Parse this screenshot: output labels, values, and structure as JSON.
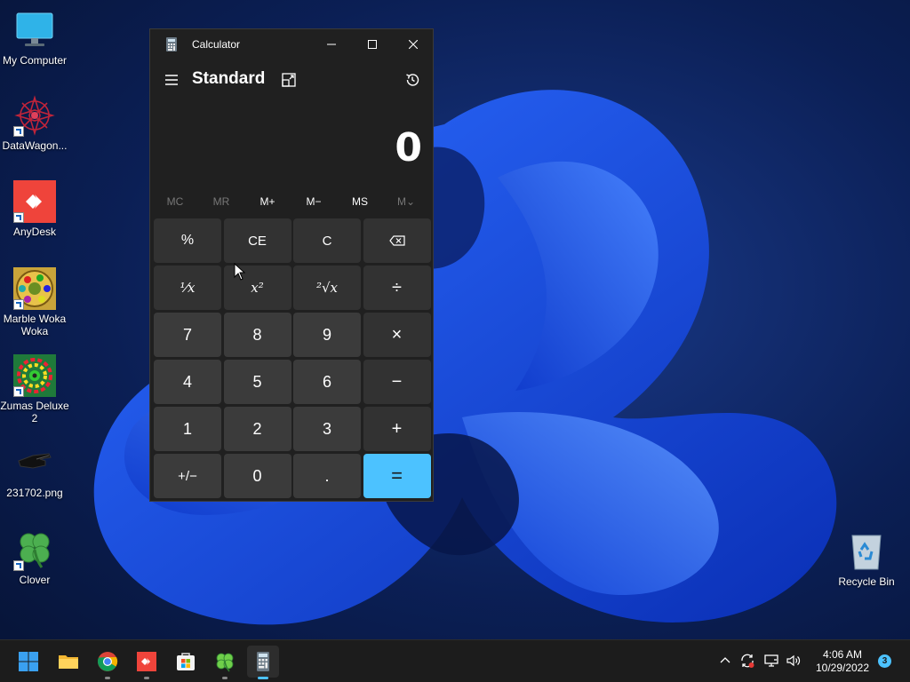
{
  "desktop": {
    "icons": [
      {
        "label": "My Computer",
        "icon": "monitor-icon"
      },
      {
        "label": "DataWagon...",
        "icon": "datawagon-icon"
      },
      {
        "label": "AnyDesk",
        "icon": "anydesk-icon"
      },
      {
        "label": "Marble Woka Woka",
        "icon": "marble-game-icon"
      },
      {
        "label": "Zumas Deluxe 2",
        "icon": "zuma-game-icon"
      },
      {
        "label": "231702.png",
        "icon": "image-file-icon"
      },
      {
        "label": "Clover",
        "icon": "clover-icon"
      },
      {
        "label": "Recycle Bin",
        "icon": "recycle-bin-icon"
      }
    ]
  },
  "calculator": {
    "window_title": "Calculator",
    "mode": "Standard",
    "display_value": "0",
    "memory": [
      {
        "label": "MC",
        "enabled": false
      },
      {
        "label": "MR",
        "enabled": false
      },
      {
        "label": "M+",
        "enabled": true
      },
      {
        "label": "M−",
        "enabled": true
      },
      {
        "label": "MS",
        "enabled": true
      },
      {
        "label": "M⌄",
        "enabled": false
      }
    ],
    "keys": [
      [
        "%",
        "CE",
        "C",
        "⌫"
      ],
      [
        "¹⁄x",
        "x²",
        "²√x",
        "÷"
      ],
      [
        "7",
        "8",
        "9",
        "×"
      ],
      [
        "4",
        "5",
        "6",
        "−"
      ],
      [
        "1",
        "2",
        "3",
        "+"
      ],
      [
        "+/−",
        "0",
        ".",
        "="
      ]
    ],
    "accent_color": "#4cc2ff"
  },
  "taskbar": {
    "apps": [
      "start-icon",
      "file-explorer-icon",
      "chrome-icon",
      "anydesk-icon",
      "store-icon",
      "clover-icon",
      "calculator-icon"
    ],
    "clock_time": "4:06 AM",
    "clock_date": "10/29/2022",
    "notification_count": "3"
  }
}
